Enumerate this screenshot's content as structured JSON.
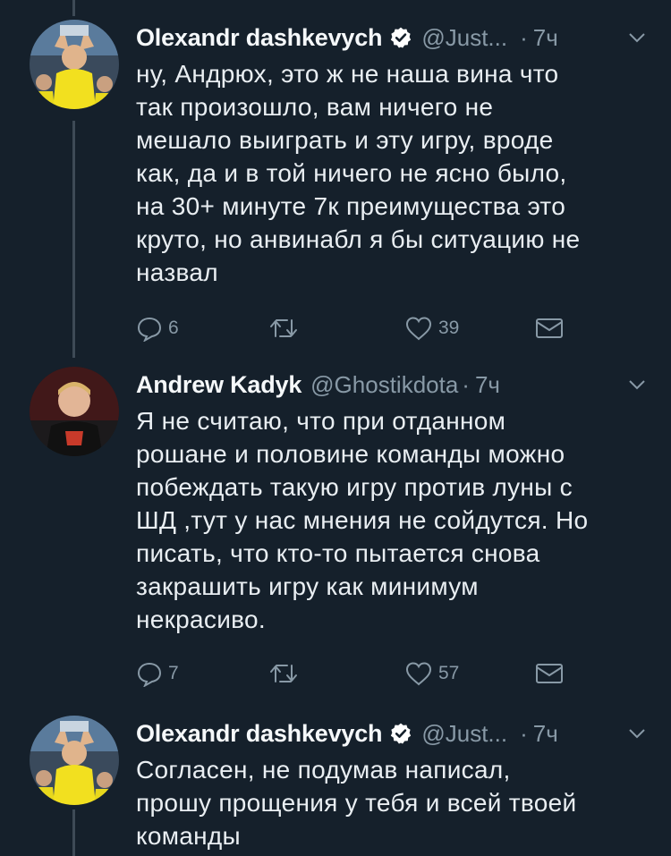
{
  "tweets": [
    {
      "name": "Olexandr dashkevych",
      "verified": true,
      "handle": "@Just...",
      "time": "7ч",
      "lines": [
        "ну, Андрюх, это ж не наша вина что",
        "так произошло, вам ничего не",
        "мешало выиграть и эту игру, вроде",
        "как, да и в той ничего не ясно было,",
        "на 30+ минуте 7к преимущества это",
        "круто, но анвинабл я бы ситуацию не",
        "назвал"
      ],
      "replies": "6",
      "retweets": "",
      "likes": "39"
    },
    {
      "name": "Andrew Kadyk",
      "verified": false,
      "handle": "@Ghostikdota",
      "time": "7ч",
      "lines": [
        "Я не считаю, что при отданном",
        "рошане и половине команды можно",
        "побеждать такую игру против луны с",
        "ШД ,тут у нас мнения не сойдутся. Но",
        "писать, что кто-то пытается снова",
        "закрашить игру как минимум",
        "некрасиво."
      ],
      "replies": "7",
      "retweets": "",
      "likes": "57"
    },
    {
      "name": "Olexandr dashkevych",
      "verified": true,
      "handle": "@Just...",
      "time": "7ч",
      "lines": [
        "Согласен, не подумав написал,",
        "прошу прощения у тебя и всей твоей",
        "команды"
      ]
    }
  ],
  "icons": {
    "reply": "reply-icon",
    "retweet": "retweet-icon",
    "like": "heart-icon",
    "message": "envelope-icon",
    "more": "chevron-down-icon",
    "verified": "verified-badge-icon"
  },
  "colors": {
    "background": "#15202b",
    "text": "#e9eef2",
    "muted": "#8899a6",
    "thread_line": "#3e4a56",
    "verified_badge": "#ffffff"
  }
}
